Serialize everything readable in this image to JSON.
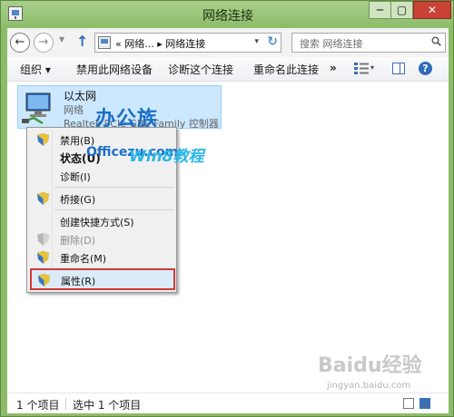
{
  "window": {
    "title": "网络连接",
    "minimize": "─",
    "maximize": "▢",
    "close": "✕"
  },
  "nav": {
    "back": "←",
    "forward": "→",
    "history": "▼",
    "up": "↑",
    "address": "« 网络... ▸ 网络连接",
    "address_dropdown": "▾",
    "refresh": "↻",
    "search_placeholder": "搜索 网络连接"
  },
  "commands": {
    "organize": "组织 ▾",
    "disable": "禁用此网络设备",
    "diagnose": "诊断这个连接",
    "rename": "重命名此连接",
    "more": "»",
    "view_dropdown": "▾",
    "help": "?"
  },
  "item": {
    "name": "以太网",
    "status": "网络",
    "device": "Realtek PCIe GBE Family 控制器"
  },
  "context_menu": {
    "items": [
      {
        "label": "禁用(B)"
      },
      {
        "label": "状态(U)"
      },
      {
        "label": "诊断(I)"
      },
      {
        "label": "桥接(G)"
      },
      {
        "label": "创建快捷方式(S)"
      },
      {
        "label": "删除(D)"
      },
      {
        "label": "重命名(M)"
      },
      {
        "label": "属性(R)"
      }
    ]
  },
  "statusbar": {
    "count": "1 个项目",
    "selected": "选中 1 个项目"
  },
  "watermark": {
    "brand": "办公族",
    "site": "Officezu.com",
    "tutorial": "Win8教程",
    "baidu": "Baidu经验",
    "baidu_url": "jingyan.baidu.com"
  },
  "colors": {
    "title_bar": "#8cbc69",
    "close_button": "#c94235",
    "selection": "#cce8ff",
    "highlight_border": "#d43a3a",
    "accent": "#2f6bb8"
  }
}
